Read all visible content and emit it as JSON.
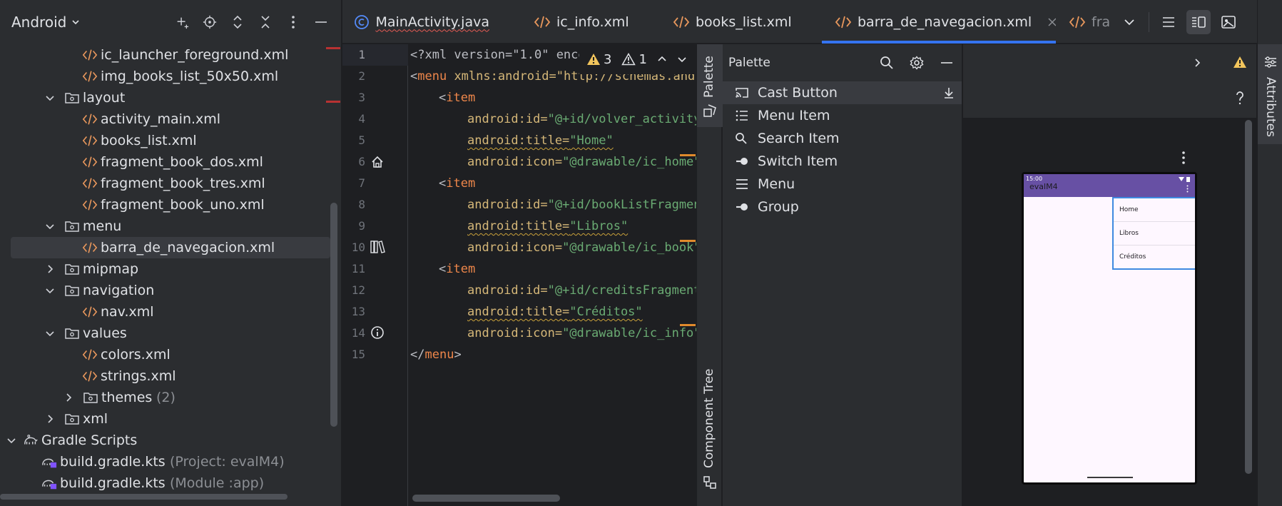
{
  "project": {
    "view_label": "Android",
    "tree": [
      {
        "label": "ic_launcher_foreground.xml",
        "type": "xml"
      },
      {
        "label": "img_books_list_50x50.xml",
        "type": "xml"
      },
      {
        "label": "layout",
        "type": "folder",
        "expanded": true
      },
      {
        "label": "activity_main.xml",
        "type": "xml"
      },
      {
        "label": "books_list.xml",
        "type": "xml"
      },
      {
        "label": "fragment_book_dos.xml",
        "type": "xml"
      },
      {
        "label": "fragment_book_tres.xml",
        "type": "xml"
      },
      {
        "label": "fragment_book_uno.xml",
        "type": "xml"
      },
      {
        "label": "menu",
        "type": "folder",
        "expanded": true
      },
      {
        "label": "barra_de_navegacion.xml",
        "type": "xml",
        "selected": true
      },
      {
        "label": "mipmap",
        "type": "folder",
        "expanded": false
      },
      {
        "label": "navigation",
        "type": "folder",
        "expanded": true
      },
      {
        "label": "nav.xml",
        "type": "xml"
      },
      {
        "label": "values",
        "type": "folder",
        "expanded": true
      },
      {
        "label": "colors.xml",
        "type": "xml"
      },
      {
        "label": "strings.xml",
        "type": "xml"
      },
      {
        "label": "themes",
        "count": "(2)",
        "type": "folder",
        "expanded": false
      },
      {
        "label": "xml",
        "type": "folder",
        "expanded": false
      },
      {
        "label": "Gradle Scripts",
        "type": "gradle-root",
        "expanded": true
      },
      {
        "label": "build.gradle.kts",
        "note": "(Project: evalM4)",
        "type": "gradle"
      },
      {
        "label": "build.gradle.kts",
        "note": "(Module :app)",
        "type": "gradle"
      }
    ]
  },
  "tabs": [
    {
      "label": "MainActivity.java",
      "icon": "java-class-icon"
    },
    {
      "label": "ic_info.xml",
      "icon": "xml-icon"
    },
    {
      "label": "books_list.xml",
      "icon": "xml-icon"
    },
    {
      "label": "barra_de_navegacion.xml",
      "icon": "xml-icon",
      "active": true
    },
    {
      "label": "fra",
      "icon": "xml-icon"
    }
  ],
  "editor": {
    "warnings": "3",
    "weak_warnings": "1",
    "line_numbers": [
      "1",
      "2",
      "3",
      "4",
      "5",
      "6",
      "7",
      "8",
      "9",
      "10",
      "11",
      "12",
      "13",
      "14",
      "15"
    ],
    "lines": {
      "l1": {
        "a": "<?xml version=\"1.0\" enco"
      },
      "l2": {
        "a": "<",
        "b": "menu",
        "c": " xmlns:android=\"http://schemas.andr"
      },
      "l3": {
        "a": "<",
        "b": "item"
      },
      "l4": {
        "a": "android:id=",
        "b": "\"@+id/volver_activity"
      },
      "l5": {
        "a": "android:title=",
        "b": "\"Home\""
      },
      "l6": {
        "a": "android:icon=",
        "b": "\"@drawable/ic_home\""
      },
      "l7": {
        "a": "<",
        "b": "item"
      },
      "l8": {
        "a": "android:id=",
        "b": "\"@+id/bookListFragmen"
      },
      "l9": {
        "a": "android:title=",
        "b": "\"Libros\""
      },
      "l10": {
        "a": "android:icon=",
        "b": "\"@drawable/ic_book\""
      },
      "l11": {
        "a": "<",
        "b": "item"
      },
      "l12": {
        "a": "android:id=",
        "b": "\"@+id/creditsFragment"
      },
      "l13": {
        "a": "android:title=",
        "b": "\"Créditos\""
      },
      "l14": {
        "a": "android:icon=",
        "b": "\"@drawable/ic_info\""
      },
      "l15": {
        "a": "</",
        "b": "menu",
        "c": ">"
      }
    }
  },
  "side": {
    "palette_label": "Palette",
    "component_tree_label": "Component Tree",
    "attributes_label": "Attributes"
  },
  "palette": {
    "title": "Palette",
    "items": [
      {
        "label": "Cast Button",
        "icon": "cast-icon"
      },
      {
        "label": "Menu Item",
        "icon": "menu-item-icon"
      },
      {
        "label": "Search Item",
        "icon": "search-item-icon"
      },
      {
        "label": "Switch Item",
        "icon": "switch-icon"
      },
      {
        "label": "Menu",
        "icon": "menu-icon"
      },
      {
        "label": "Group",
        "icon": "group-icon"
      }
    ]
  },
  "preview": {
    "time": "15:00",
    "app_name": "evalM4",
    "menu_items": [
      "Home",
      "Libros",
      "Créditos"
    ]
  },
  "colors": {
    "accent": "#3574f0",
    "phone_bar": "#6750a4",
    "warning": "#f2c55c"
  }
}
